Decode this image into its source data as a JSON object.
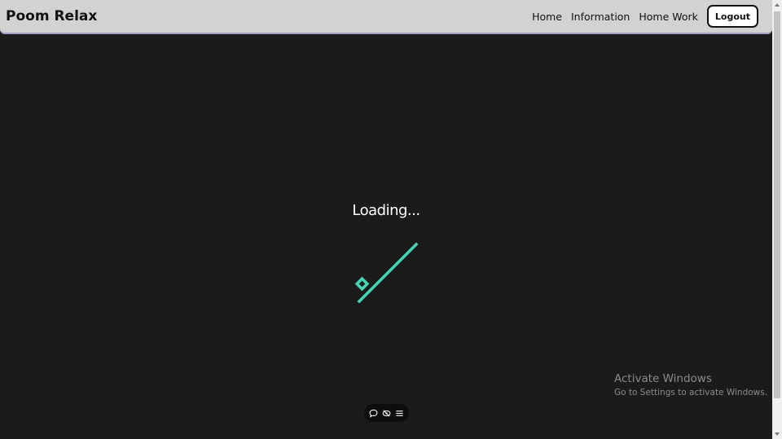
{
  "navbar": {
    "brand": "Poom Relax",
    "links": [
      "Home",
      "Information",
      "Home Work"
    ],
    "logout_label": "Logout"
  },
  "loader": {
    "text": "Loading...",
    "accent_color": "#46d6b3"
  },
  "toolbar": {
    "icons": [
      "chat-bubble-icon",
      "eye-slash-icon",
      "menu-icon"
    ]
  },
  "watermark": {
    "title": "Activate Windows",
    "subtitle": "Go to Settings to activate Windows."
  },
  "colors": {
    "background": "#1b1b1b",
    "navbar": "#d2d2d2",
    "accent": "#46d6b3"
  }
}
